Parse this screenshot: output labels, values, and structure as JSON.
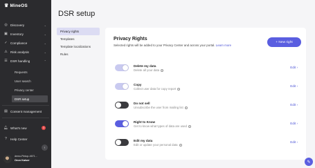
{
  "app": {
    "logo_text": "MineOS"
  },
  "sidebar": {
    "items": [
      {
        "label": "Discovery",
        "icon": "discovery-icon"
      },
      {
        "label": "Inventory",
        "icon": "inventory-icon"
      },
      {
        "label": "Compliance",
        "icon": "compliance-icon"
      },
      {
        "label": "Risk analysis",
        "icon": "risk-icon"
      },
      {
        "label": "DSR handling",
        "icon": "dsr-icon"
      }
    ],
    "sub_items": [
      "Requests",
      "User search",
      "Privacy center",
      "DSR setup"
    ],
    "consent": "Consent management",
    "whats_new": "What's new",
    "whats_new_badge": "3",
    "help": "Help Center",
    "account": {
      "org": "demo-Pintop-4671...",
      "user": "Oron Kaiser"
    }
  },
  "page": {
    "title": "DSR setup"
  },
  "subnav": [
    "Privacy rights",
    "Templates",
    "Template localizations",
    "Rules"
  ],
  "panel": {
    "title": "Privacy Rights",
    "description": "Selected rights will be added to your Privacy Center and across your portal.",
    "learn_more": "Learn more",
    "new_button": "+ New right",
    "rights": [
      {
        "name": "Delete my data",
        "desc": "Delete all your data",
        "enabled": true,
        "edit": "Edit"
      },
      {
        "name": "Copy",
        "desc": "Collect user data for copy report",
        "enabled": true,
        "edit": "Edit"
      },
      {
        "name": "Do not sell",
        "desc": "Unsubscribe the user from mailing list",
        "enabled": false,
        "edit": "Edit"
      },
      {
        "name": "Right to Know",
        "desc": "Get to know what types of data are used",
        "enabled": true,
        "edit": "Edit"
      },
      {
        "name": "Edit my data",
        "desc": "Edit or update your personal data",
        "enabled": false,
        "edit": "Edit"
      }
    ]
  },
  "colors": {
    "accent": "#5a5ee0",
    "sidebar_bg": "#2b2b2e",
    "link": "#4a52d6"
  }
}
